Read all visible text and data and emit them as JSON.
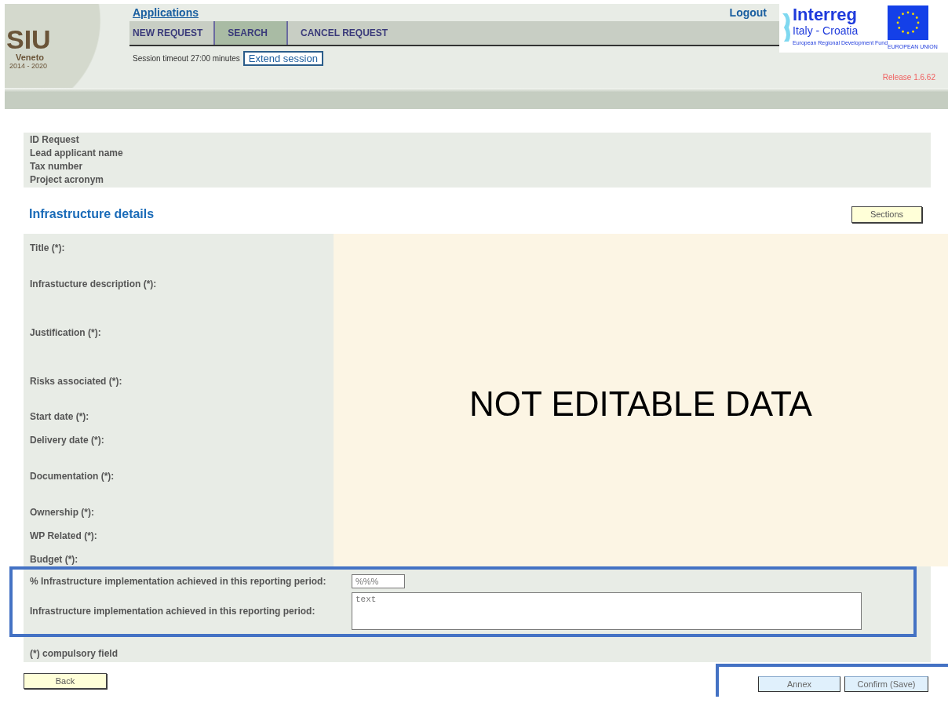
{
  "header": {
    "logo": {
      "title": "SIU",
      "subtitle": "Veneto",
      "years": "2014 - 2020"
    },
    "applications_link": "Applications",
    "logout": "Logout",
    "tabs": [
      {
        "label": "NEW REQUEST",
        "selected": false
      },
      {
        "label": "SEARCH",
        "selected": true
      },
      {
        "label": "CANCEL REQUEST",
        "selected": false
      }
    ],
    "session_text": "Session timeout 27:00 minutes",
    "extend_button": "Extend session",
    "partner_logo": {
      "name": "Interreg",
      "region": "Italy - Croatia",
      "fund": "European Regional Development Fund",
      "eu": "EUROPEAN UNION"
    },
    "release": "Release 1.6.62"
  },
  "request_info": [
    "ID Request",
    "Lead applicant name",
    "Tax number",
    "Project acronym"
  ],
  "section_title": "Infrastructure details",
  "sections_button": "Sections",
  "fields": [
    "Title (*):",
    "Infrastucture description (*):",
    "Justification (*):",
    "Risks associated (*):",
    "Start date (*):",
    "Delivery date (*):",
    "Documentation (*):",
    "Ownership (*):",
    "WP Related (*):",
    "Budget (*):"
  ],
  "not_editable_note": "NOT EDITABLE DATA",
  "editable_fields": [
    {
      "kind": "input",
      "label": "% Infrastructure implementation achieved in this reporting period:",
      "value": "%%%"
    },
    {
      "kind": "textarea",
      "label": "Infrastructure implementation achieved in this reporting period:",
      "value": "text"
    }
  ],
  "compulsory_note": "(*) compulsory field",
  "buttons": {
    "back": "Back",
    "annex": "Annex",
    "confirm": "Confirm (Save)"
  }
}
